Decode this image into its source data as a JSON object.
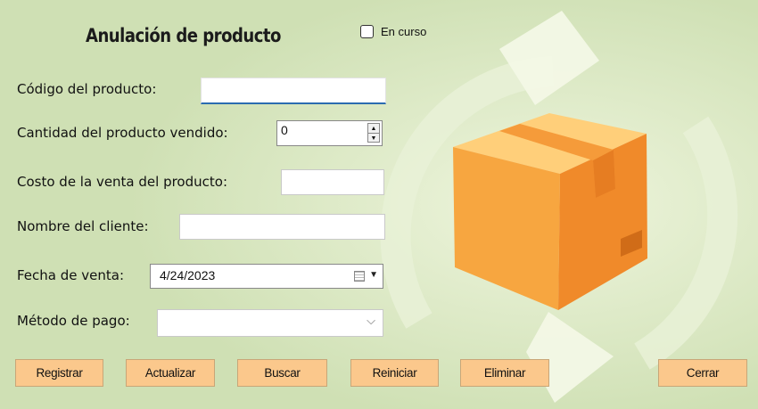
{
  "form": {
    "title": "Anulación de producto",
    "en_curso_label": "En curso",
    "codigo_label": "Código del producto:",
    "codigo_value": "",
    "cantidad_label": "Cantidad del producto vendido:",
    "cantidad_value": "0",
    "costo_label": "Costo de la venta del producto:",
    "costo_value": "",
    "cliente_label": "Nombre del cliente:",
    "cliente_value": "",
    "fecha_label": "Fecha de venta:",
    "fecha_value": "4/24/2023",
    "metodo_label": "Método de pago:",
    "metodo_value": ""
  },
  "buttons": {
    "registrar": "Registrar",
    "actualizar": "Actualizar",
    "buscar": "Buscar",
    "reiniciar": "Reiniciar",
    "eliminar": "Eliminar",
    "cerrar": "Cerrar"
  },
  "icons": {
    "box": "cardboard-box-icon",
    "cycle": "refresh-arrows-icon",
    "calendar": "calendar-icon",
    "dropdown": "chevron-down-icon"
  },
  "colors": {
    "background": "#cfe0b4",
    "button": "#fbc88c",
    "box_orange": "#f7a640",
    "focus_underline": "#2b6cb0"
  }
}
